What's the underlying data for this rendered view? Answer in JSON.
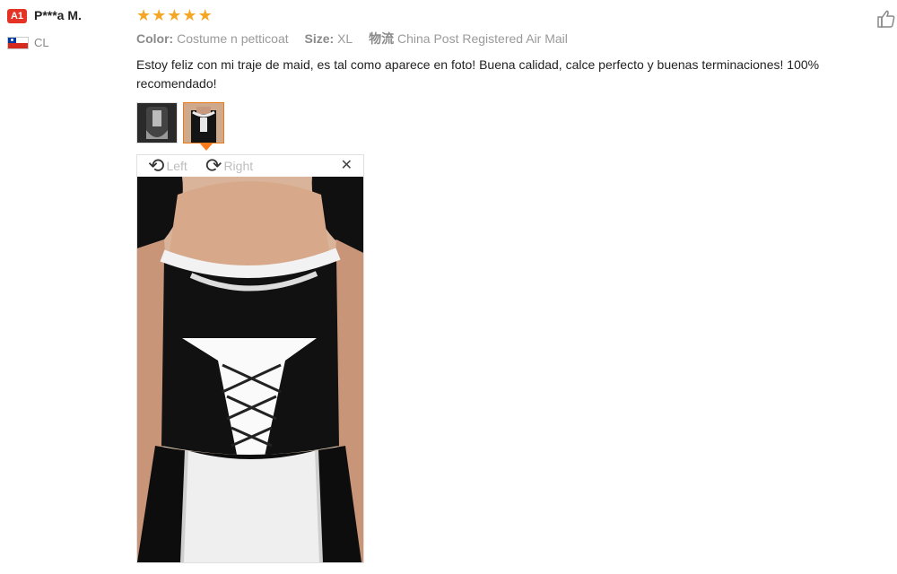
{
  "reviewer": {
    "badge": "A1",
    "name": "P***a M.",
    "country_code": "CL",
    "flag_icon": "chile-flag-icon"
  },
  "rating": {
    "stars": 5,
    "max": 5,
    "color": "#f5a623"
  },
  "meta": {
    "color_label": "Color:",
    "color_value": "Costume n petticoat",
    "size_label": "Size:",
    "size_value": "XL",
    "shipping_label": "物流",
    "shipping_value": "China Post Registered Air Mail"
  },
  "review": {
    "text": "Estoy feliz con mi traje de maid, es tal como aparece en foto! Buena calidad, calce perfecto y buenas terminaciones! 100% recomendado!"
  },
  "thumbnails": {
    "count": 2,
    "selected_index": 1
  },
  "viewer": {
    "rotate_left_label": "Left",
    "rotate_right_label": "Right",
    "close_icon": "close-icon"
  },
  "colors": {
    "accent": "#e87a1a",
    "badge": "#e43225"
  }
}
